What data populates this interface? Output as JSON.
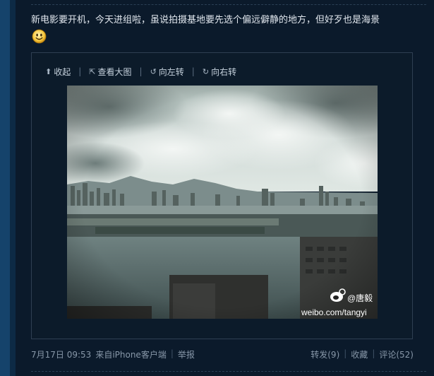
{
  "post": {
    "text": "新电影要开机，今天进组啦，虽说拍摄基地要先选个偏远僻静的地方，但好歹也是海景",
    "emoji": "smile-emoji"
  },
  "toolbar": {
    "collapse": "收起",
    "view_large": "查看大图",
    "rotate_left": "向左转",
    "rotate_right": "向右转",
    "icons": [
      "collapse-arrow-icon",
      "external-view-icon",
      "rotate-left-icon",
      "rotate-right-icon"
    ]
  },
  "photo": {
    "watermark_name": "@唐毅",
    "watermark_url": "weibo.com/tangyi"
  },
  "footer": {
    "timestamp": "7月17日 09:53",
    "source": "来自iPhone客户端",
    "report": "举报",
    "repost": "转发(9)",
    "favorite": "收藏",
    "comment": "评论(52)"
  },
  "colors": {
    "background": "#0b1a2b",
    "side_bar": "#15436b",
    "text": "#e1e7ee",
    "muted": "#8797a8"
  }
}
